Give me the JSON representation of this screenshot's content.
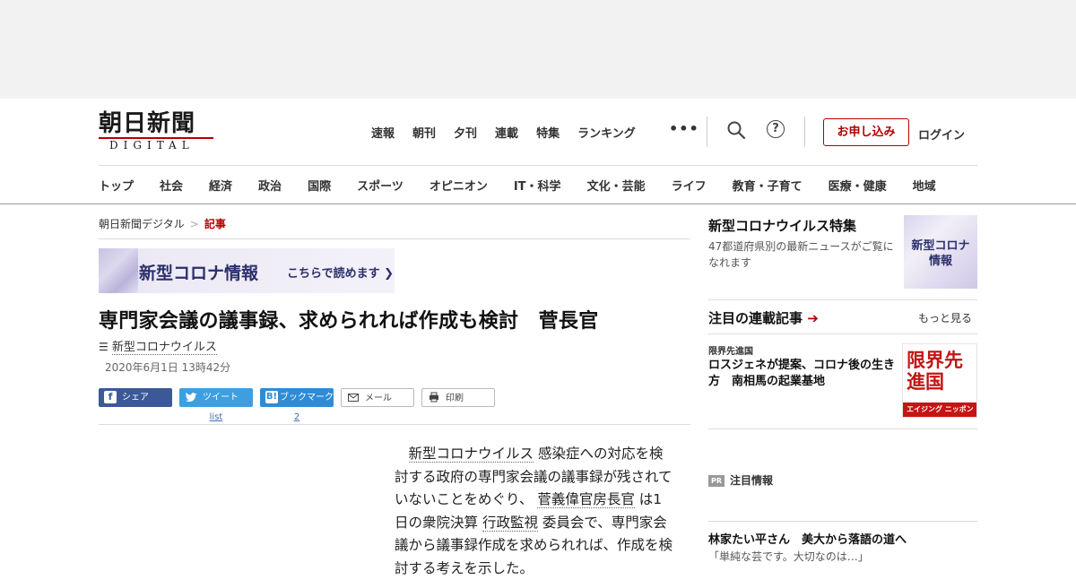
{
  "header": {
    "logo_jp": "朝日新聞",
    "logo_en": "DIGITAL",
    "topnav": [
      "速報",
      "朝刊",
      "夕刊",
      "連載",
      "特集",
      "ランキング"
    ],
    "more": "•••",
    "apply_label": "お申し込み",
    "login_label": "ログイン",
    "categories": [
      "トップ",
      "社会",
      "経済",
      "政治",
      "国際",
      "スポーツ",
      "オピニオン",
      "IT・科学",
      "文化・芸能",
      "ライフ",
      "教育・子育て",
      "医療・健康",
      "地域"
    ]
  },
  "breadcrumb": {
    "home": "朝日新聞デジタル",
    "separator": ">",
    "current": "記事"
  },
  "corona_banner": {
    "title": "新型コロナ情報",
    "link": "こちらで読めます"
  },
  "article": {
    "headline": "専門家会議の議事録、求められれば作成も検討　菅長官",
    "tag": "新型コロナウイルス",
    "date": "2020年6月1日 13時42分",
    "share": {
      "facebook": "シェア",
      "twitter": "ツイート",
      "twitter_count": "list",
      "hatena": "ブックマーク",
      "hatena_count": "2",
      "mail": "メール",
      "print": "印刷"
    },
    "body": {
      "link1": "新型コロナウイルス",
      "t1": "感染症への対応を検討する政府の専門家会議の議事録が残されていないことをめぐり、",
      "link2": "菅義偉官房長官",
      "t2": "は1日の衆院決算",
      "link3": "行政監視",
      "t3": "委員会で、専門家会議から議事録作成を求められれば、作成を検討する考えを示した。"
    }
  },
  "sidebar": {
    "feature_title": "新型コロナウイルス特集",
    "feature_desc": "47都道府県別の最新ニュースがご覧になれます",
    "feature_thumb": "新型コロナ情報",
    "series_title": "注目の連載記事",
    "series_arrow": "➔",
    "more_label": "もっと見る",
    "series_label": "限界先進国",
    "series_headline": "ロスジェネが提案、コロナ後の生き方　南相馬の起業基地",
    "series_thumb_big": "限界先進国",
    "series_thumb_bar": "エイジング ニッポン",
    "pr_badge": "PR",
    "pr_label": "注目情報",
    "pr_headline": "林家たい平さん　美大から落語の道へ",
    "pr_sub": "「単純な芸です。大切なのは…」"
  }
}
